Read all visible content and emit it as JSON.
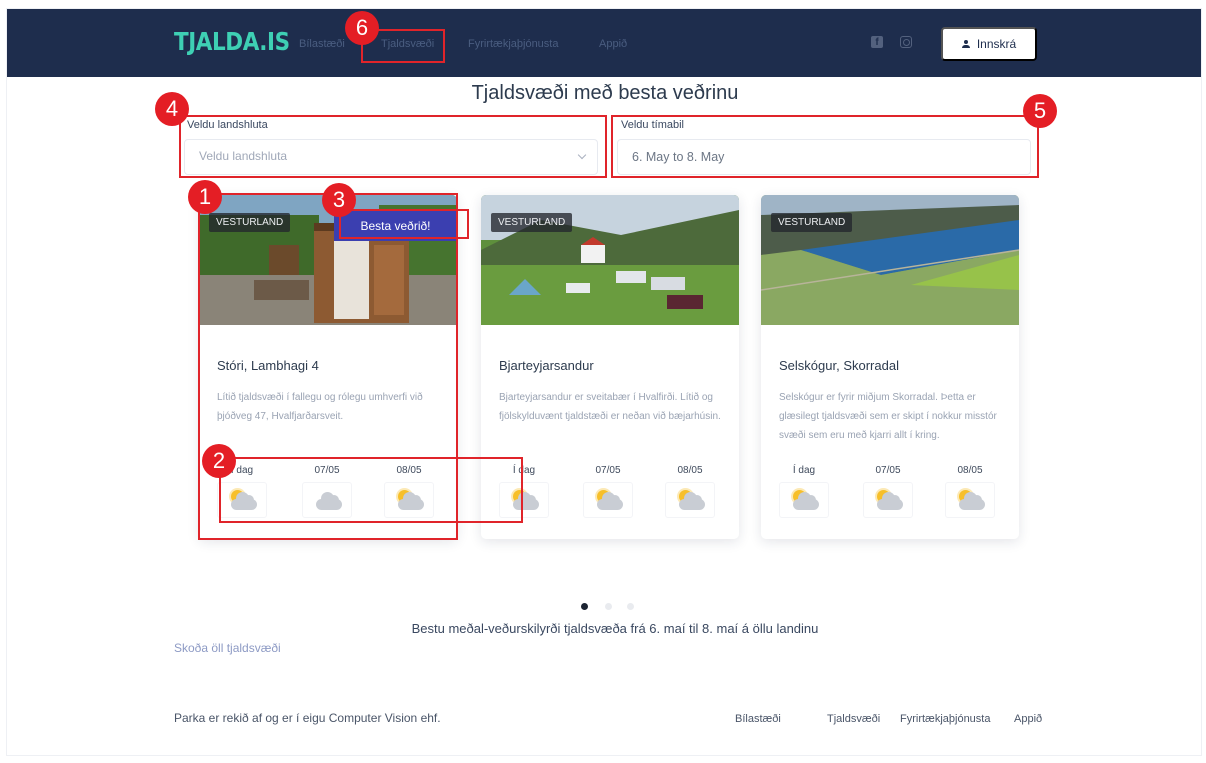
{
  "navbar": {
    "logo": "TJALDA.IS",
    "links": [
      "Bílastæði",
      "Tjaldsvæði",
      "Fyrirtækjaþjónusta",
      "Appið"
    ],
    "login_label": "Innskrá"
  },
  "page_title": "Tjaldsvæði með besta veðrinu",
  "filters": {
    "region_label": "Veldu landshluta",
    "region_placeholder": "Veldu landshluta",
    "period_label": "Veldu tímabil",
    "period_value": "6. May to 8. May"
  },
  "cards": [
    {
      "region": "VESTURLAND",
      "badge": "Besta veðrið!",
      "title": "Stóri, Lambhagi 4",
      "description": "Lítið tjaldsvæði í fallegu og rólegu umhverfi við þjóðveg 47, Hvalfjarðarsveit.",
      "weather": [
        {
          "day": "Í dag",
          "icon": "partly-cloudy-icon"
        },
        {
          "day": "07/05",
          "icon": "cloudy-icon"
        },
        {
          "day": "08/05",
          "icon": "partly-cloudy-icon"
        }
      ]
    },
    {
      "region": "VESTURLAND",
      "title": "Bjarteyjarsandur",
      "description": "Bjarteyjarsandur er sveitabær í Hvalfirði. Lítið og fjölskylduvænt tjaldstæði er neðan við bæjarhúsin.",
      "weather": [
        {
          "day": "Í dag",
          "icon": "partly-cloudy-icon"
        },
        {
          "day": "07/05",
          "icon": "partly-cloudy-icon"
        },
        {
          "day": "08/05",
          "icon": "partly-cloudy-icon"
        }
      ]
    },
    {
      "region": "VESTURLAND",
      "title": "Selskógur, Skorradal",
      "description": "Selskógur er fyrir miðjum Skorradal. Þetta er glæsilegt tjaldsvæði sem er skipt í nokkur misstór svæði sem eru með kjarri allt í kring.",
      "weather": [
        {
          "day": "Í dag",
          "icon": "partly-cloudy-icon"
        },
        {
          "day": "07/05",
          "icon": "partly-cloudy-icon"
        },
        {
          "day": "08/05",
          "icon": "partly-cloudy-icon"
        }
      ]
    }
  ],
  "carousel": {
    "page_count": 3,
    "active_index": 0
  },
  "caption": "Bestu meðal-veðurskilyrði tjaldsvæða frá 6. maí til 8. maí á öllu landinu",
  "see_all": "Skoða öll tjaldsvæði",
  "footer": {
    "text": "Parka er rekið af og er í eigu Computer Vision ehf.",
    "links": [
      "Bílastæði",
      "Tjaldsvæði",
      "Fyrirtækjaþjónusta",
      "Appið"
    ]
  },
  "annotations": [
    "1",
    "2",
    "3",
    "4",
    "5",
    "6"
  ],
  "colors": {
    "navbar": "#1e2d4d",
    "logo": "#3ed0b4",
    "best_badge": "#3b3fb0",
    "annotation": "#e41e25"
  }
}
